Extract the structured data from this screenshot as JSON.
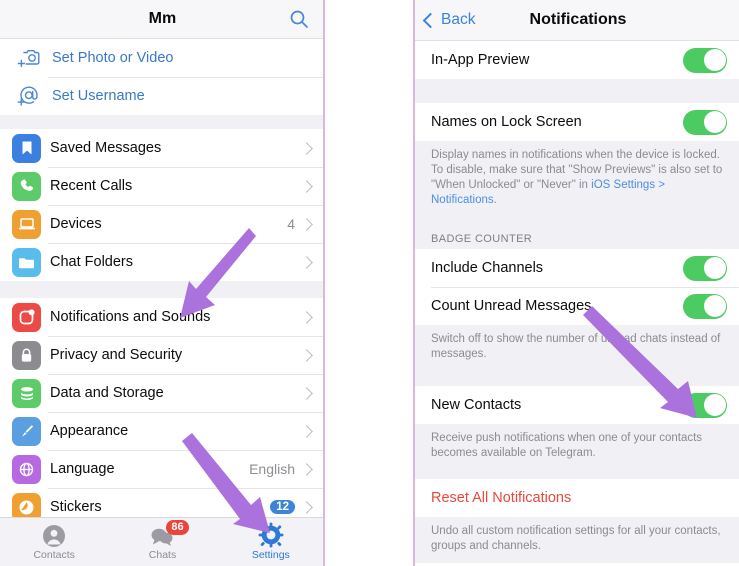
{
  "left_panel": {
    "navbar": {
      "title": "Mm",
      "search_icon": "search-icon"
    },
    "account_group": [
      {
        "icon": "add-photo-icon",
        "label": "Set Photo or Video"
      },
      {
        "icon": "add-username-icon",
        "label": "Set Username"
      }
    ],
    "main_group": [
      {
        "icon": "bookmark-icon",
        "label": "Saved Messages",
        "value": ""
      },
      {
        "icon": "phone-icon",
        "label": "Recent Calls",
        "value": ""
      },
      {
        "icon": "laptop-icon",
        "label": "Devices",
        "value": "4"
      },
      {
        "icon": "folder-icon",
        "label": "Chat Folders",
        "value": ""
      }
    ],
    "settings_group": [
      {
        "icon": "notifications-icon",
        "label": "Notifications and Sounds",
        "value": ""
      },
      {
        "icon": "lock-icon",
        "label": "Privacy and Security",
        "value": ""
      },
      {
        "icon": "database-icon",
        "label": "Data and Storage",
        "value": ""
      },
      {
        "icon": "brush-icon",
        "label": "Appearance",
        "value": ""
      },
      {
        "icon": "globe-icon",
        "label": "Language",
        "value": "English"
      },
      {
        "icon": "stickers-icon",
        "label": "Stickers",
        "value": "12"
      }
    ],
    "tabbar": [
      {
        "icon": "contacts-icon",
        "label": "Contacts",
        "badge": "",
        "active": false
      },
      {
        "icon": "chats-icon",
        "label": "Chats",
        "badge": "86",
        "active": false
      },
      {
        "icon": "gear-icon",
        "label": "Settings",
        "badge": "",
        "active": true
      }
    ]
  },
  "right_panel": {
    "navbar": {
      "back_label": "Back",
      "title": "Notifications"
    },
    "row_in_app_preview": {
      "label": "In-App Preview",
      "toggle": "on"
    },
    "row_names_lock": {
      "label": "Names on Lock Screen",
      "toggle": "on"
    },
    "footer_names_lock": {
      "text_before": "Display names in notifications when the device is locked. To disable, make sure that \"Show Previews\" is also set to \"When Unlocked\" or \"Never\" in ",
      "link": "iOS Settings > Notifications",
      "text_after": "."
    },
    "badge_counter_header": "BADGE COUNTER",
    "row_include_channels": {
      "label": "Include Channels",
      "toggle": "on"
    },
    "row_count_unread": {
      "label": "Count Unread Messages",
      "toggle": "on"
    },
    "footer_badge_counter": "Switch off to show the number of unread chats instead of messages.",
    "row_new_contacts": {
      "label": "New Contacts",
      "toggle": "on"
    },
    "footer_new_contacts": "Receive push notifications when one of your contacts becomes available on Telegram.",
    "row_reset": {
      "label": "Reset All Notifications"
    },
    "footer_reset": "Undo all custom notification settings for all your contacts, groups and channels."
  },
  "annotations": {
    "arrow_color": "#ab72de",
    "arrows": [
      {
        "name": "arrow-to-notifications-and-sounds"
      },
      {
        "name": "arrow-to-settings-tab"
      },
      {
        "name": "arrow-to-new-contacts-toggle"
      }
    ]
  },
  "colors": {
    "accent_blue": "#3b82e0",
    "toggle_green": "#4ccb63",
    "danger_red": "#e8493f",
    "badge_red": "#e8453c",
    "badge_blue": "#3d84d6",
    "panel_border": "#dcb6e0"
  }
}
